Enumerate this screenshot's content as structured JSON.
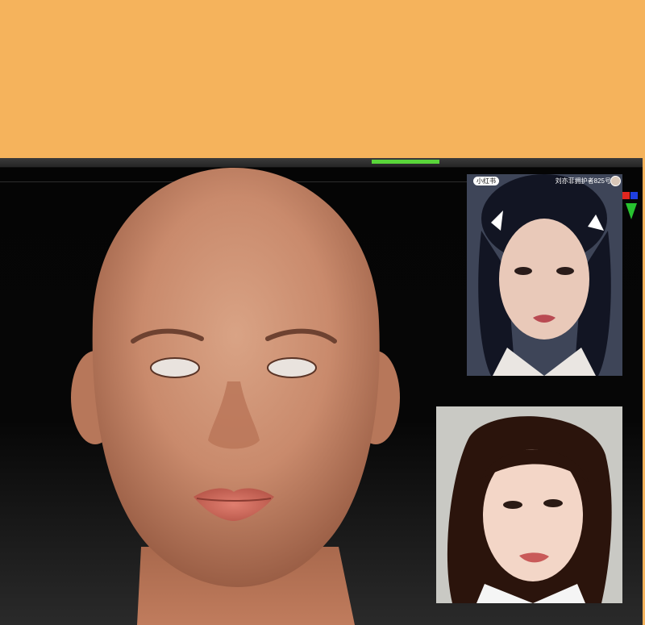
{
  "top_band": {
    "color": "#f5b35c"
  },
  "viewport": {
    "frame_color": "#1e1e1e",
    "progress_fraction": 1.0,
    "progress_color": "#59d53a"
  },
  "model": {
    "description_icon": "bald-head-sculpt",
    "skin_tone": "#c98a6c"
  },
  "reference_top": {
    "tag": "小红书",
    "caption": "刘亦菲拥护者825号"
  },
  "reference_bottom": {},
  "gizmo": {
    "colors": [
      "#e0261f",
      "#1f3fe0",
      "#27c22f"
    ]
  }
}
